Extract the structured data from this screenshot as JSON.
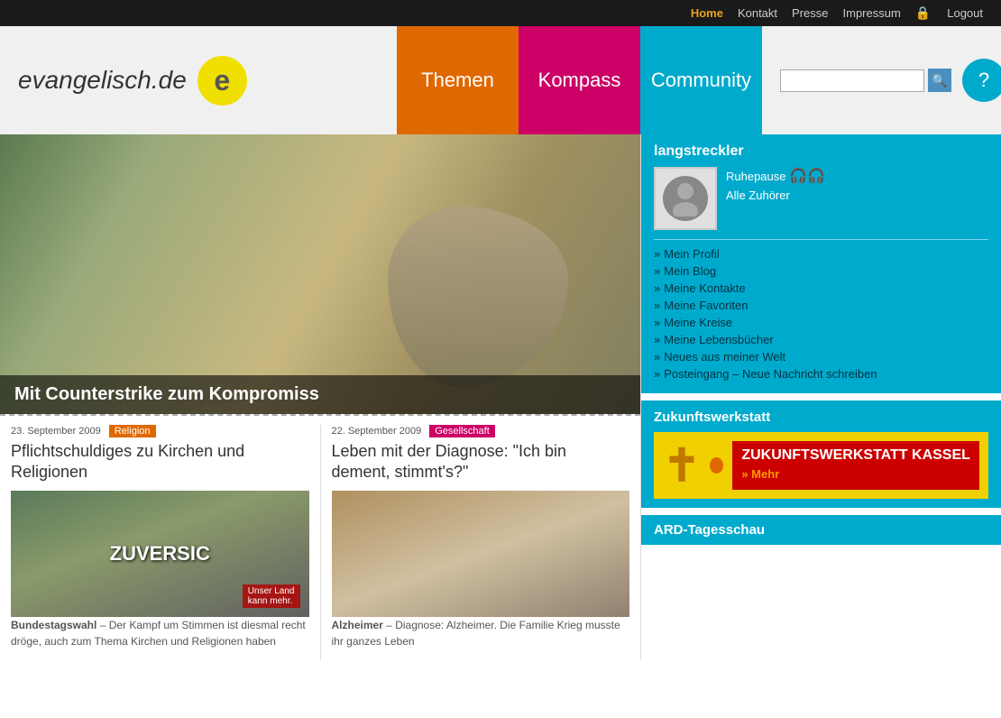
{
  "topbar": {
    "home": "Home",
    "kontakt": "Kontakt",
    "presse": "Presse",
    "impressum": "Impressum",
    "logout": "Logout"
  },
  "header": {
    "logo_text": "evangelisch.de",
    "logo_letter": "e",
    "nav_themen": "Themen",
    "nav_kompass": "Kompass",
    "nav_community": "Community",
    "search_placeholder": ""
  },
  "hero": {
    "caption": "Mit Counterstrike zum Kompromiss"
  },
  "article1": {
    "date": "23. September 2009",
    "tag": "Religion",
    "title": "Pflichtschuldiges zu Kirchen und Religionen",
    "teaser_bold": "Bundestagswahl",
    "teaser": " – Der Kampf um Stimmen ist diesmal recht dröge, auch zum Thema Kirchen und Religionen haben"
  },
  "article2": {
    "date": "22. September 2009",
    "tag": "Gesellschaft",
    "title": "Leben mit der Diagnose: \"Ich bin dement, stimmt's?\"",
    "teaser_bold": "Alzheimer",
    "teaser": " – Diagnose: Alzheimer. Die Familie Krieg musste ihr ganzes Leben"
  },
  "sidebar": {
    "username": "langstreckler",
    "status": "Ruhepause",
    "hoerer": "Alle Zuhörer",
    "links": [
      "Mein Profil",
      "Mein Blog",
      "Meine Kontakte",
      "Meine Favoriten",
      "Meine Kreise",
      "Meine Lebensbücher",
      "Neues aus meiner Welt",
      "Posteingang – Neue Nachricht schreiben"
    ],
    "zukunft_title": "Zukunftswerkstatt",
    "zukunft_banner_text": "ZUKUNFTSWERKSTATT KASSEL",
    "zukunft_mehr": "» Mehr",
    "ard_title": "ARD-Tagesschau"
  }
}
